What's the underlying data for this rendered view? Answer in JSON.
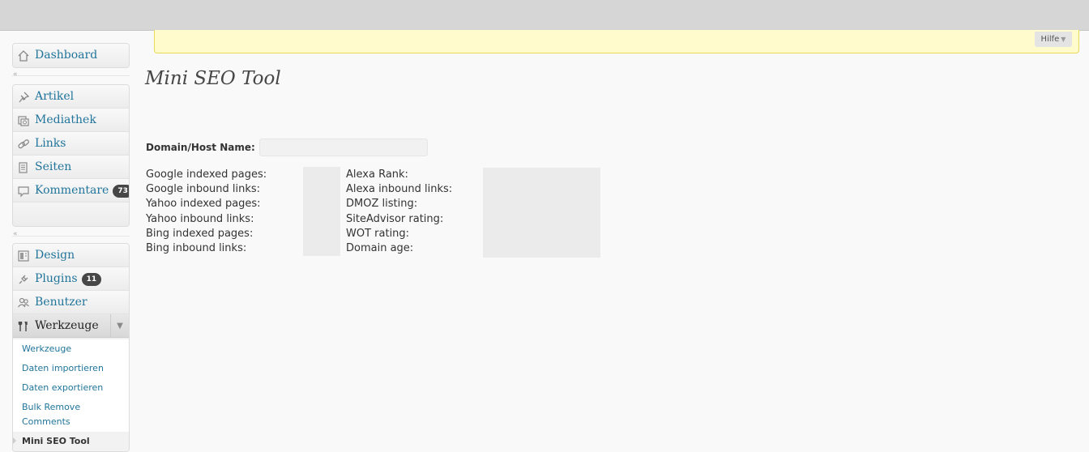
{
  "help": {
    "label": "Hilfe"
  },
  "sidebar": {
    "dashboard": "Dashboard",
    "artikel": "Artikel",
    "mediathek": "Mediathek",
    "links": "Links",
    "seiten": "Seiten",
    "kommentare": "Kommentare",
    "kommentare_count": "73",
    "design": "Design",
    "plugins": "Plugins",
    "plugins_count": "11",
    "benutzer": "Benutzer",
    "werkzeuge": "Werkzeuge",
    "submenu": {
      "werkzeuge": "Werkzeuge",
      "daten_importieren": "Daten importieren",
      "daten_exportieren": "Daten exportieren",
      "bulk_remove_1": "Bulk Remove",
      "bulk_remove_2": "Comments",
      "mini_seo": "Mini SEO Tool"
    }
  },
  "main": {
    "title": "Mini SEO Tool",
    "domain_label": "Domain/Host Name:",
    "domain_value": "",
    "left_stats": [
      "Google indexed pages:",
      "Google inbound links:",
      "Yahoo indexed pages:",
      "Yahoo inbound links:",
      "Bing indexed pages:",
      "Bing inbound links:"
    ],
    "right_stats": [
      "Alexa Rank:",
      "Alexa inbound links:",
      "DMOZ listing:",
      "SiteAdvisor rating:",
      "WOT rating:",
      "Domain age:"
    ]
  }
}
